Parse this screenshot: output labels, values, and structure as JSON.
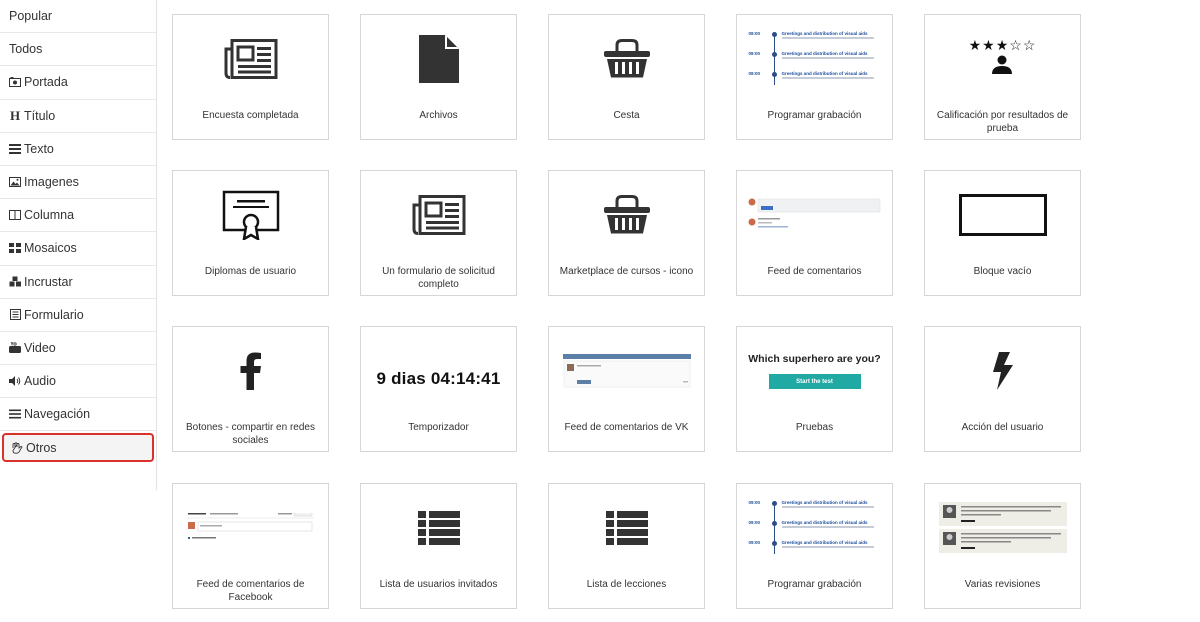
{
  "sidebar": {
    "items": [
      {
        "label": "Popular",
        "icon": "none"
      },
      {
        "label": "Todos",
        "icon": "none"
      },
      {
        "label": "Portada",
        "icon": "camera-icon"
      },
      {
        "label": "Título",
        "icon": "heading-icon"
      },
      {
        "label": "Texto",
        "icon": "text-lines-icon"
      },
      {
        "label": "Imagenes",
        "icon": "image-icon"
      },
      {
        "label": "Columna",
        "icon": "columns-icon"
      },
      {
        "label": "Mosaicos",
        "icon": "tiles-icon"
      },
      {
        "label": "Incrustar",
        "icon": "cubes-icon"
      },
      {
        "label": "Formulario",
        "icon": "form-icon"
      },
      {
        "label": "Video",
        "icon": "youtube-icon"
      },
      {
        "label": "Audio",
        "icon": "speaker-icon"
      },
      {
        "label": "Navegación",
        "icon": "menu-icon"
      },
      {
        "label": "Otros",
        "icon": "hand-icon",
        "active": true
      }
    ]
  },
  "cards": [
    {
      "label": "Encuesta completada",
      "preview": "newspaper-icon"
    },
    {
      "label": "Archivos",
      "preview": "file-icon"
    },
    {
      "label": "Cesta",
      "preview": "basket-icon"
    },
    {
      "label": "Programar grabación",
      "preview": "timeline-preview"
    },
    {
      "label": "Calificación por resultados de prueba",
      "preview": "stars-user-icon"
    },
    {
      "label": "Diplomas de usuario",
      "preview": "certificate-icon"
    },
    {
      "label": "Un formulario de solicitud completo",
      "preview": "newspaper-icon"
    },
    {
      "label": "Marketplace de cursos - icono",
      "preview": "basket-icon"
    },
    {
      "label": "Feed de comentarios",
      "preview": "comments-preview"
    },
    {
      "label": "Bloque vacío",
      "preview": "empty-block"
    },
    {
      "label": "Botones - compartir en redes sociales",
      "preview": "facebook-icon"
    },
    {
      "label": "Temporizador",
      "preview": "timer-text"
    },
    {
      "label": "Feed de comentarios de VK",
      "preview": "vk-comments-preview"
    },
    {
      "label": "Pruebas",
      "preview": "quiz-preview"
    },
    {
      "label": "Acción del usuario",
      "preview": "lightning-icon"
    },
    {
      "label": "Feed de comentarios de Facebook",
      "preview": "fb-comments-preview"
    },
    {
      "label": "Lista de usuarios invitados",
      "preview": "list-icon"
    },
    {
      "label": "Lista de lecciones",
      "preview": "list-icon"
    },
    {
      "label": "Programar grabación",
      "preview": "timeline-preview"
    },
    {
      "label": "Varias revisiones",
      "preview": "reviews-preview"
    }
  ],
  "previews": {
    "timeline": {
      "entries": [
        {
          "time": "09:00",
          "title": "Greetings and distribution of visual aids"
        },
        {
          "time": "09:00",
          "title": "Greetings and distribution of visual aids"
        },
        {
          "time": "09:00",
          "title": "Greetings and distribution of visual aids"
        }
      ]
    },
    "timer_text": "9 dias 04:14:41",
    "quiz": {
      "title": "Which superhero are you?",
      "button": "Start the test"
    }
  },
  "colors": {
    "active_border": "#d9312b",
    "quiz_button": "#21a9a3",
    "timeline_accent": "#1b4d9b"
  }
}
